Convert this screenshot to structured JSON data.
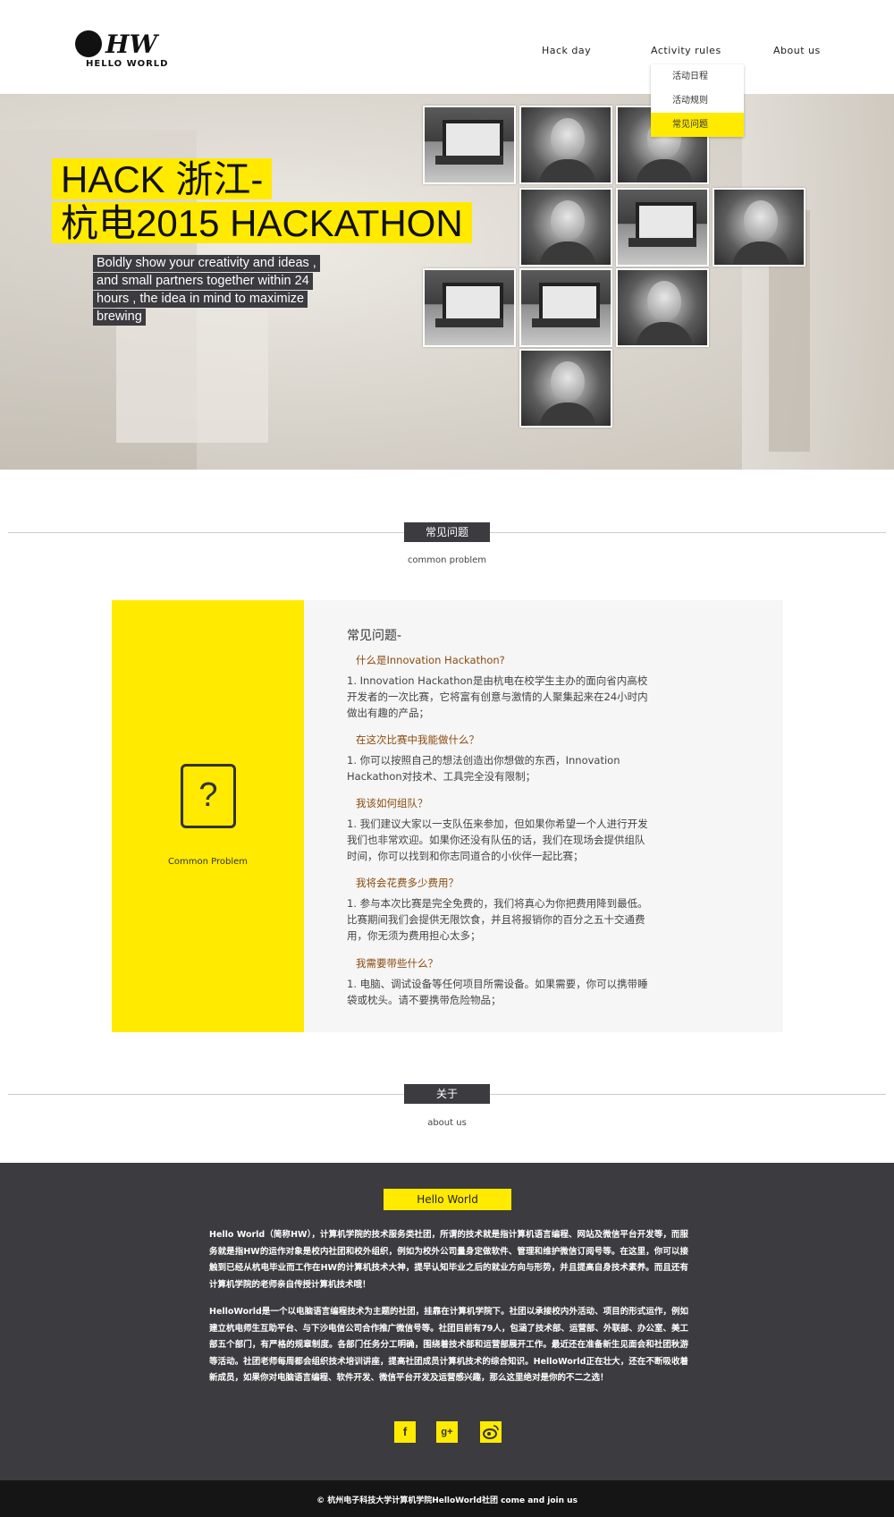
{
  "header": {
    "logo_text": "HW",
    "logo_sub": "HELLO WORLD",
    "nav": [
      "Hack day",
      "Activity rules",
      "About us"
    ],
    "dropdown": [
      "活动日程",
      "活动规则",
      "常见问题"
    ],
    "dropdown_active": "常见问题"
  },
  "hero": {
    "title_line1": "HACK 浙江-",
    "title_line2": "杭电2015 HACKATHON",
    "desc_lines": [
      "Boldly show your creativity and ideas ,",
      "and small partners together within 24",
      "hours , the idea in mind to maximize",
      "brewing"
    ]
  },
  "faq_section": {
    "tag": "常见问题",
    "subtitle": "common problem",
    "icon_glyph": "?",
    "icon_label": "Common Problem",
    "heading": "常见问题-",
    "items": [
      {
        "q": "什么是Innovation Hackathon?",
        "a": [
          "1. Innovation Hackathon是由杭电在校学生主办的面向省内高校",
          "开发者的一次比赛，它将富有创意与激情的人聚集起来在24小时内",
          "做出有趣的产品；"
        ]
      },
      {
        "q": "在这次比赛中我能做什么？",
        "a": [
          "1. 你可以按照自己的想法创造出你想做的东西，Innovation",
          "Hackathon对技术、工具完全没有限制；"
        ]
      },
      {
        "q": "我该如何组队？",
        "a": [
          "1. 我们建议大家以一支队伍来参加，但如果你希望一个人进行开发",
          "我们也非常欢迎。如果你还没有队伍的话，我们在现场会提供组队",
          "时间，你可以找到和你志同道合的小伙伴一起比赛；"
        ]
      },
      {
        "q": "我将会花费多少费用？",
        "a": [
          "1. 参与本次比赛是完全免费的，我们将真心为你把费用降到最低。",
          "比赛期间我们会提供无限饮食，并且将报销你的百分之五十交通费",
          "用，你无须为费用担心太多；"
        ]
      },
      {
        "q": "我需要带些什么？",
        "a": [
          "1. 电脑、调试设备等任何项目所需设备。如果需要，你可以携带睡",
          "袋或枕头。请不要携带危险物品；"
        ]
      }
    ]
  },
  "about_section": {
    "tag": "关于",
    "subtitle": "about us"
  },
  "footer": {
    "tag": "Hello World",
    "para1": "Hello World（简称HW），计算机学院的技术服务类社团，所谓的技术就是指计算机语言编程、网站及微信平台开发等，而服务就是指HW的运作对象是校内社团和校外组织，例如为校外公司量身定做软件、管理和维护微信订阅号等。在这里，你可以接触到已经从杭电毕业而工作在HW的计算机技术大神，提早认知毕业之后的就业方向与形势，并且提高自身技术素养。而且还有计算机学院的老师亲自传授计算机技术哦！",
    "para2": "HelloWorld是一个以电脑语言编程技术为主题的社团，挂靠在计算机学院下。社团以承接校内外活动、项目的形式运作，例如建立杭电师生互助平台、与下沙电信公司合作推广微信号等。社团目前有79人，包涵了技术部、运营部、外联部、办公室、美工部五个部门，有严格的规章制度。各部门任务分工明确，围绕着技术部和运营部展开工作。最近还在准备新生见面会和社团秋游等活动。社团老师每周都会组织技术培训讲座，提高社团成员计算机技术的综合知识。HelloWorld正在壮大，还在不断吸收着新成员，如果你对电脑语言编程、软件开发、微信平台开发及运营感兴趣，那么这里绝对是你的不二之选！",
    "social": [
      "f",
      "g+",
      "weibo"
    ],
    "copyright": "© 杭州电子科技大学计算机学院HelloWorld社团    come and join us"
  },
  "colors": {
    "accent": "#ffea00",
    "dark": "#3c3b3f",
    "question": "#8a4b0f",
    "bottom": "#151515"
  }
}
